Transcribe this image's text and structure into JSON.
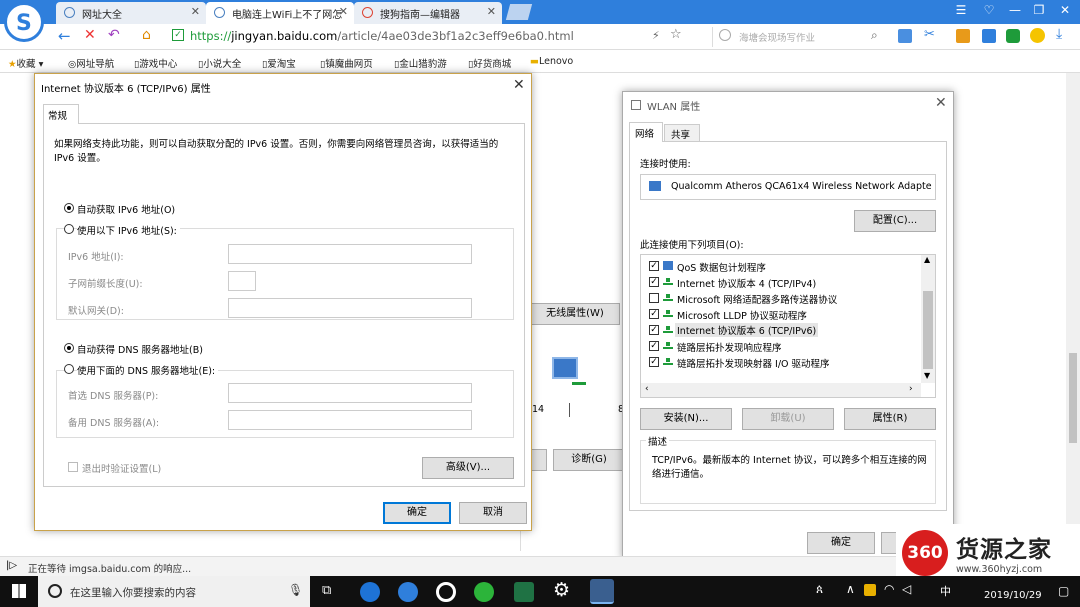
{
  "browser": {
    "tabs": [
      {
        "label": "网址大全"
      },
      {
        "label": "电脑连上WiFi上不了网怎"
      },
      {
        "label": "搜狗指南—编辑器"
      }
    ],
    "url_prefix": "https://",
    "url_domain": "jingyan.baidu.com",
    "url_path": "/article/4ae03de3bf1a2c3eff9e6ba0.html",
    "search_placeholder": "海塘会现场写作业",
    "bookmarks": [
      "收藏",
      "网址导航",
      "游戏中心",
      "小说大全",
      "爱淘宝",
      "镇魔曲网页",
      "金山猎豹游",
      "好货商城",
      "Lenovo"
    ]
  },
  "ipv6_dialog": {
    "title": "Internet 协议版本 6 (TCP/IPv6) 属性",
    "tab": "常规",
    "intro": "如果网络支持此功能，则可以自动获取分配的 IPv6 设置。否则，你需要向网络管理员咨询，以获得适当的 IPv6 设置。",
    "auto_ip": "自动获取 IPv6 地址(O)",
    "manual_ip": "使用以下 IPv6 地址(S):",
    "ip_label": "IPv6 地址(I):",
    "prefix_label": "子网前缀长度(U):",
    "gateway_label": "默认网关(D):",
    "auto_dns": "自动获得 DNS 服务器地址(B)",
    "manual_dns": "使用下面的 DNS 服务器地址(E):",
    "pref_dns": "首选 DNS 服务器(P):",
    "alt_dns": "备用 DNS 服务器(A):",
    "validate": "退出时验证设置(L)",
    "advanced": "高级(V)...",
    "ok": "确定",
    "cancel": "取消"
  },
  "wlan_dialog": {
    "title": "WLAN 属性",
    "tab_network": "网络",
    "tab_share": "共享",
    "connect_using": "连接时使用:",
    "adapter": "Qualcomm Atheros QCA61x4 Wireless Network Adapte",
    "configure": "配置(C)...",
    "items_label": "此连接使用下列项目(O):",
    "items": [
      {
        "label": "QoS 数据包计划程序",
        "checked": true
      },
      {
        "label": "Internet 协议版本 4 (TCP/IPv4)",
        "checked": true
      },
      {
        "label": "Microsoft 网络适配器多路传送器协议",
        "checked": false
      },
      {
        "label": "Microsoft LLDP 协议驱动程序",
        "checked": true
      },
      {
        "label": "Internet 协议版本 6 (TCP/IPv6)",
        "checked": true
      },
      {
        "label": "链路层拓扑发现响应程序",
        "checked": true
      },
      {
        "label": "链路层拓扑发现映射器 I/O 驱动程序",
        "checked": true
      }
    ],
    "install": "安装(N)...",
    "uninstall": "卸载(U)",
    "properties": "属性(R)",
    "desc_label": "描述",
    "description": "TCP/IPv6。最新版本的 Internet 协议，可以跨多个相互连接的网络进行通信。",
    "ok": "确定"
  },
  "background": {
    "wireless_props": "无线属性(W)",
    "diagnose": "诊断(G)",
    "num_left": "14",
    "num_right": "8"
  },
  "statusbar": {
    "text": "正在等待 imgsa.baidu.com 的响应..."
  },
  "taskbar": {
    "search_placeholder": "在这里输入你要搜索的内容",
    "date": "2019/10/29",
    "ime": "中"
  },
  "watermark": {
    "logo": "360",
    "name": "货源之家",
    "url": "www.360hyzj.com"
  }
}
